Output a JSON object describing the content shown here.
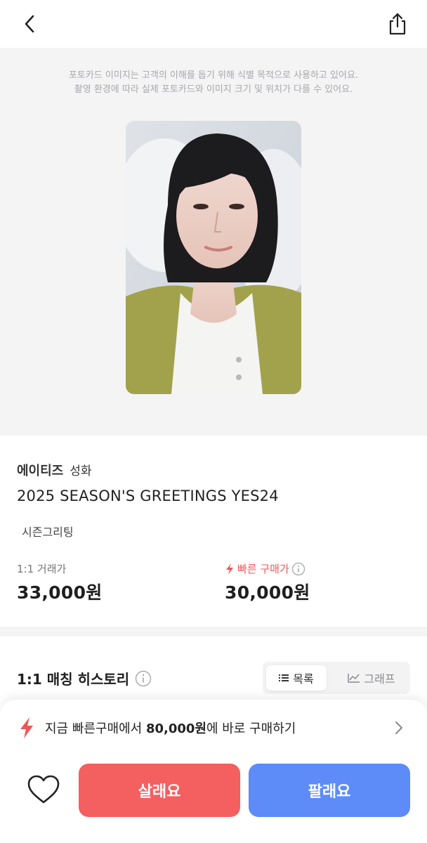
{
  "header": {
    "back_icon": "chevron-left-icon",
    "share_icon": "share-icon"
  },
  "notice": {
    "line1": "포토카드 이미지는 고객의 이해를 돕기 위해 식별 목적으로 사용하고 있어요.",
    "line2": "촬영 환경에 따라 실제 포토카드와 이미지 크기 및 위치가 다를 수 있어요."
  },
  "product": {
    "artist": "에이티즈",
    "member": "성화",
    "album": "2025 SEASON'S GREETINGS YES24",
    "category": "시즌그리팅"
  },
  "prices": {
    "trade_label": "1:1 거래가",
    "trade_value": "33,000원",
    "fast_label": "빠른 구매가",
    "fast_value": "30,000원",
    "fast_color": "#f25555"
  },
  "history": {
    "title": "1:1 매칭 히스토리",
    "tabs": [
      {
        "label": "목록",
        "icon": "list-icon",
        "active": true
      },
      {
        "label": "그래프",
        "icon": "line-chart-icon",
        "active": false
      }
    ]
  },
  "promo": {
    "prefix": "지금 빠른구매에서 ",
    "amount": "80,000원",
    "suffix": "에 바로 구매하기",
    "icon": "lightning-icon"
  },
  "actions": {
    "buy_label": "살래요",
    "sell_label": "팔래요",
    "buy_color": "#f45f5f",
    "sell_color": "#5d8cf8",
    "wishlist_icon": "heart-icon"
  }
}
